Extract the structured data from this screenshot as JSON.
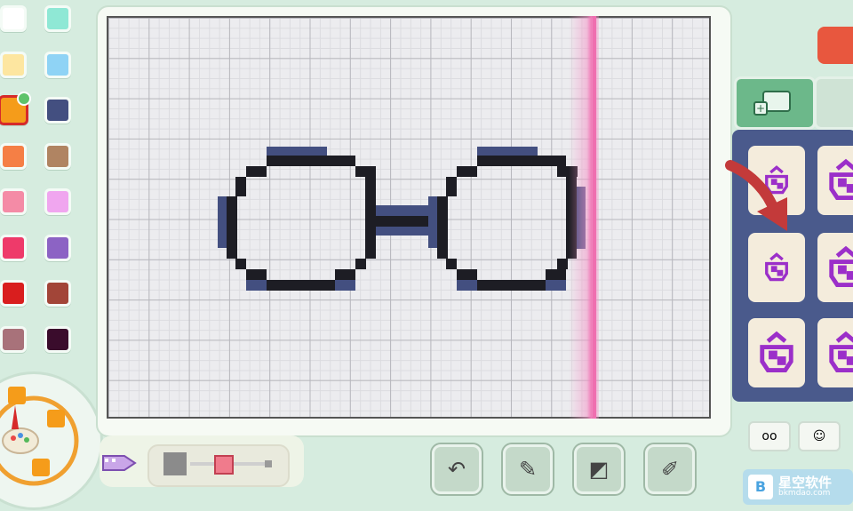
{
  "palette": {
    "colors": [
      [
        "#ffffff",
        "#8fe8d5"
      ],
      [
        "#fde6a0",
        "#8fd3f5"
      ],
      [
        "#f59c1a",
        "#434f80"
      ],
      [
        "#f57f45",
        "#b08462"
      ],
      [
        "#f48ba6",
        "#f0a6ef"
      ],
      [
        "#ee3a6a",
        "#8c63c4"
      ],
      [
        "#d91e1e",
        "#a24538"
      ],
      [
        "#a8727a",
        "#3a0c2c"
      ]
    ],
    "selected_row": 2,
    "selected_col": 0
  },
  "tool_wheel": {
    "icon": "paint-palette-icon"
  },
  "canvas": {
    "grid_cols": 60,
    "grid_rows": 40,
    "drawing": "glasses"
  },
  "brush_size": {
    "level": 0.4
  },
  "bottom_tools": [
    {
      "name": "undo-button",
      "icon": "undo-arrow-icon",
      "glyph": "↶"
    },
    {
      "name": "stamp-tool-button",
      "icon": "stamp-eraser-icon",
      "glyph": "✎"
    },
    {
      "name": "fill-tool-button",
      "icon": "bucket-icon",
      "glyph": "◩"
    },
    {
      "name": "eyedropper-button",
      "icon": "eyedropper-icon",
      "glyph": "✐"
    }
  ],
  "mini_stamps": [
    {
      "name": "mini-glasses",
      "glyph": "oo"
    },
    {
      "name": "mini-face",
      "glyph": "☺"
    }
  ],
  "watermark": {
    "text": "星空软件",
    "sub": "bkmdao.com"
  },
  "colors": {
    "accent": "#ef6fb0",
    "stamp_panel": "#4a5a8c",
    "stamp_outline": "#9b2fc9"
  }
}
